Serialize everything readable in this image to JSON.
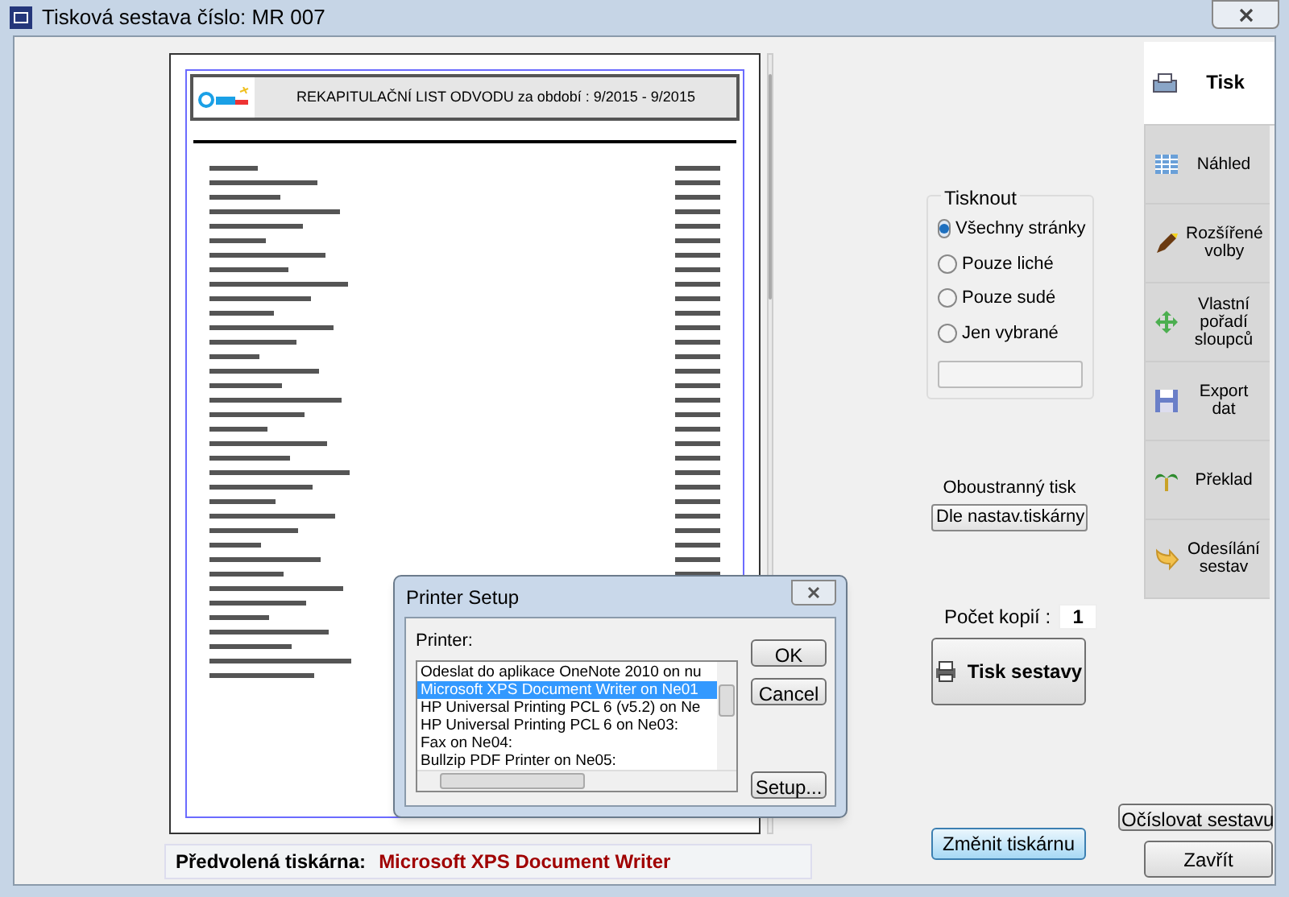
{
  "window": {
    "title": "Tisková sestava číslo:  MR 007"
  },
  "preview": {
    "report_title": "REKAPITULAČNÍ LIST ODVODU  za období : 9/2015 - 9/2015"
  },
  "tabs": [
    {
      "label": "Tisk",
      "selected": true
    },
    {
      "label": "Náhled",
      "selected": false
    },
    {
      "label": "Rozšířené volby",
      "selected": false
    },
    {
      "label": "Vlastní pořadí sloupců",
      "selected": false
    },
    {
      "label": "Export dat",
      "selected": false
    },
    {
      "label": "Překlad",
      "selected": false
    },
    {
      "label": "Odesílání sestav",
      "selected": false
    }
  ],
  "print_group": {
    "title": "Tisknout",
    "options": [
      {
        "label": "Všechny stránky",
        "selected": true
      },
      {
        "label": "Pouze liché",
        "selected": false
      },
      {
        "label": "Pouze sudé",
        "selected": false
      },
      {
        "label": "Jen vybrané",
        "selected": false
      }
    ]
  },
  "duplex": {
    "label": "Oboustranný tisk",
    "value": "Dle nastav.tiskárny"
  },
  "copies": {
    "label": "Počet kopií :",
    "value": "1"
  },
  "print_button": "Tisk sestavy",
  "change_printer_button": "Změnit tiskárnu",
  "default_printer": {
    "label": "Předvolená tiskárna:",
    "value": "Microsoft XPS Document Writer"
  },
  "side_buttons": [
    "Očíslovat sestavu",
    "Zavřít"
  ],
  "printer_dialog": {
    "title": "Printer Setup",
    "label": "Printer:",
    "printers": [
      {
        "name": "Odeslat do aplikace OneNote 2010 on nu",
        "selected": false
      },
      {
        "name": "Microsoft XPS Document Writer on Ne01",
        "selected": true
      },
      {
        "name": "HP Universal Printing PCL 6 (v5.2) on Ne",
        "selected": false
      },
      {
        "name": "HP Universal Printing PCL 6 on Ne03:",
        "selected": false
      },
      {
        "name": "Fax on Ne04:",
        "selected": false
      },
      {
        "name": "Bullzip PDF Printer on Ne05:",
        "selected": false
      }
    ],
    "buttons": [
      "OK",
      "Cancel",
      "Setup..."
    ]
  }
}
